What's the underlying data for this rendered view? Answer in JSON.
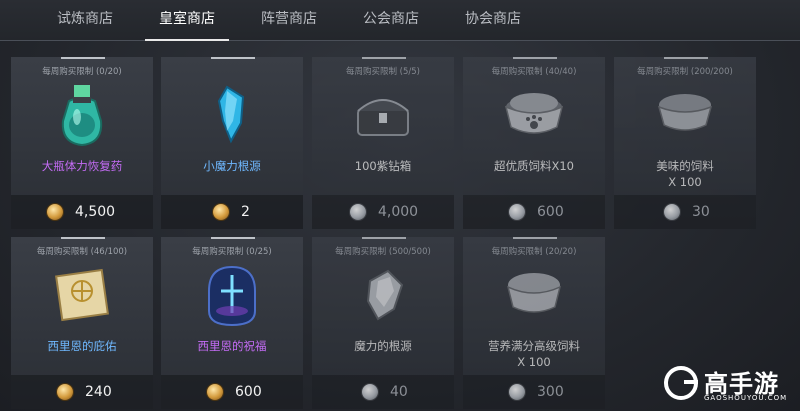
{
  "tabs": [
    {
      "label": "试炼商店",
      "active": false
    },
    {
      "label": "皇室商店",
      "active": true
    },
    {
      "label": "阵营商店",
      "active": false
    },
    {
      "label": "公会商店",
      "active": false
    },
    {
      "label": "协会商店",
      "active": false
    }
  ],
  "items": [
    {
      "limit": "每周购买限制 (0/20)",
      "name": "大瓶体力恢复药",
      "price": "4,500",
      "currency": "gold",
      "name_color": "purple",
      "icon": "potion-icon"
    },
    {
      "limit": "",
      "name": "小魔力根源",
      "price": "2",
      "currency": "gold",
      "name_color": "blue",
      "icon": "blue-crystal-icon"
    },
    {
      "limit": "每周购买限制 (5/5)",
      "name": "100紫钻箱",
      "price": "4,000",
      "currency": "silver",
      "name_color": "white",
      "icon": "chest-icon"
    },
    {
      "limit": "每周购买限制 (40/40)",
      "name": "超优质饲料X10",
      "price": "600",
      "currency": "silver",
      "name_color": "white",
      "icon": "pet-food-bowl-icon"
    },
    {
      "limit": "每周购买限制 (200/200)",
      "name": "美味的饲料",
      "name2": "X 100",
      "price": "30",
      "currency": "silver",
      "name_color": "white",
      "icon": "food-bowl-icon"
    },
    {
      "limit": "每周购买限制 (46/100)",
      "name": "西里恩的庇佑",
      "price": "240",
      "currency": "gold",
      "name_color": "blue",
      "icon": "scroll-icon"
    },
    {
      "limit": "每周购买限制 (0/25)",
      "name": "西里恩的祝福",
      "price": "600",
      "currency": "gold",
      "name_color": "purple",
      "icon": "blessing-orb-icon"
    },
    {
      "limit": "每周购买限制 (500/500)",
      "name": "魔力的根源",
      "price": "40",
      "currency": "silver",
      "name_color": "white",
      "icon": "grey-crystal-icon"
    },
    {
      "limit": "每周购买限制 (20/20)",
      "name": "营养满分高级饲料",
      "name2": "X 100",
      "price": "300",
      "currency": "silver",
      "name_color": "white",
      "icon": "food-bowl-icon"
    }
  ],
  "watermark": {
    "title": "高手游",
    "subtitle": "GAOSHOUYOU.COM"
  }
}
